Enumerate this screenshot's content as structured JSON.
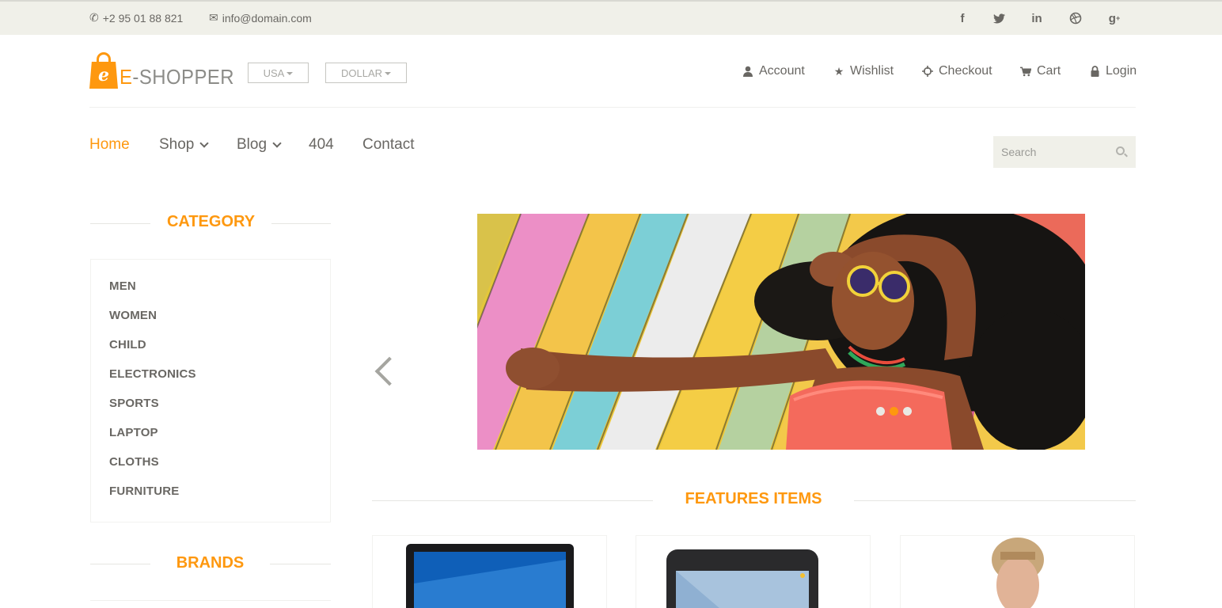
{
  "topbar": {
    "phone": "+2 95 01 88 821",
    "email": "info@domain.com",
    "social": [
      "facebook-icon",
      "twitter-icon",
      "linkedin-icon",
      "dribbble-icon",
      "google-plus-icon"
    ]
  },
  "logo": {
    "bag_letter": "e",
    "text_first": "E",
    "text_rest": "-SHOPPER"
  },
  "dropdowns": {
    "country": "USA",
    "currency": "DOLLAR"
  },
  "shop_menu": {
    "account": "Account",
    "wishlist": "Wishlist",
    "checkout": "Checkout",
    "cart": "Cart",
    "login": "Login"
  },
  "main_nav": {
    "home": "Home",
    "shop": "Shop",
    "blog": "Blog",
    "notfound": "404",
    "contact": "Contact"
  },
  "search": {
    "placeholder": "Search"
  },
  "sidebar": {
    "category_title": "CATEGORY",
    "categories": [
      "MEN",
      "WOMEN",
      "CHILD",
      "ELECTRONICS",
      "SPORTS",
      "LAPTOP",
      "CLOTHS",
      "FURNITURE"
    ],
    "brands_title": "BRANDS"
  },
  "features": {
    "title": "FEATURES ITEMS"
  },
  "colors": {
    "accent": "#fe980f",
    "topbar_bg": "#f0f0e9",
    "text": "#696763"
  }
}
